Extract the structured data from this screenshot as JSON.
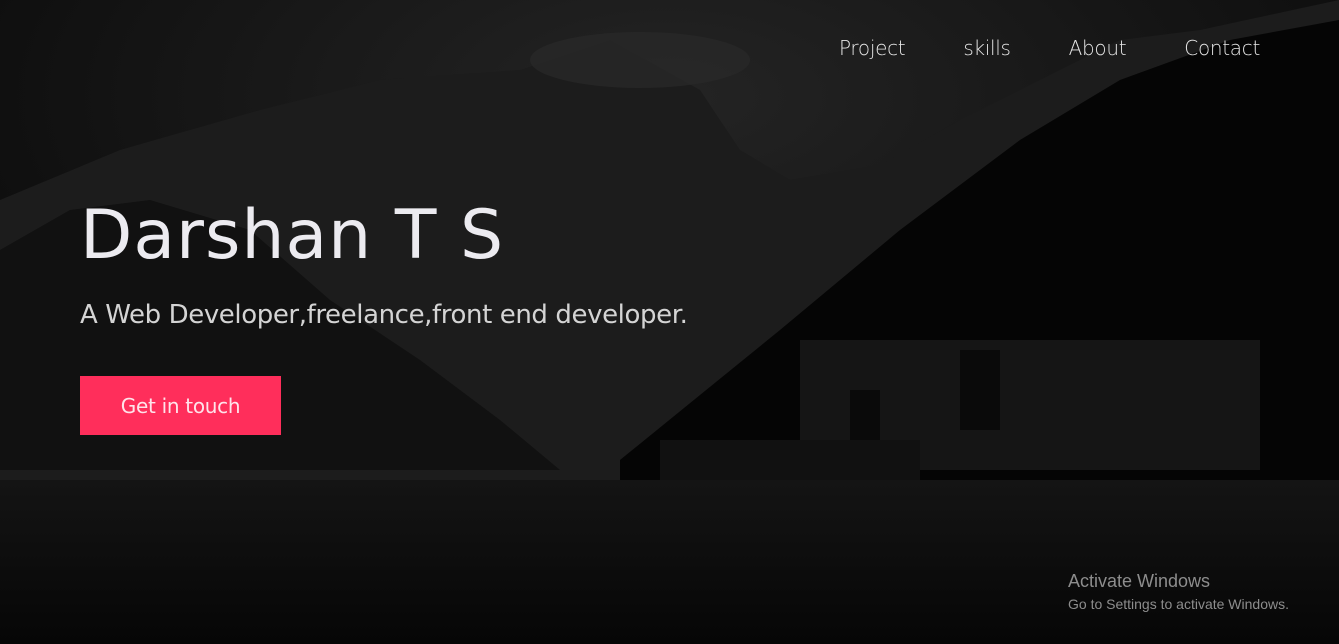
{
  "nav": {
    "items": [
      {
        "label": "Project"
      },
      {
        "label": "skills"
      },
      {
        "label": "About"
      },
      {
        "label": "Contact"
      }
    ]
  },
  "hero": {
    "title": "Darshan T S",
    "subtitle": "A Web Developer,freelance,front end developer.",
    "cta_label": "Get in touch"
  },
  "watermark": {
    "title": "Activate Windows",
    "subtitle": "Go to Settings to activate Windows."
  },
  "colors": {
    "accent": "#ff2e5b",
    "background": "#070707",
    "text": "#ecebf0"
  }
}
